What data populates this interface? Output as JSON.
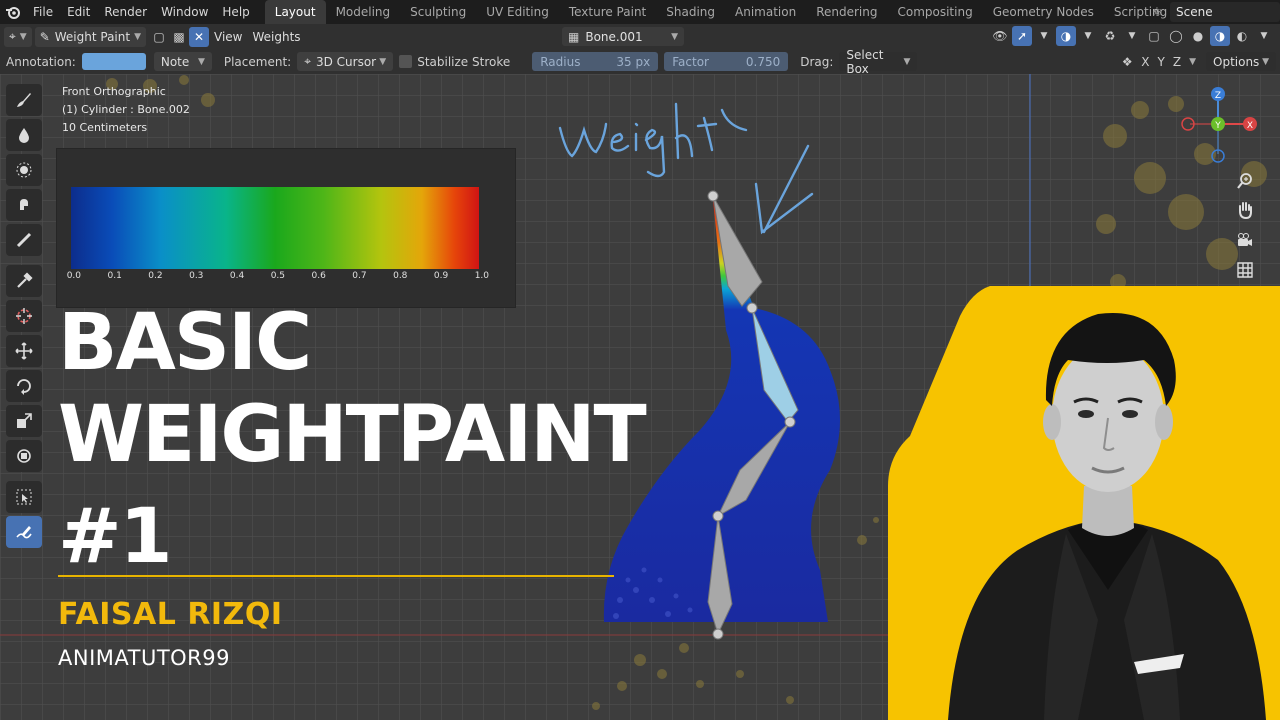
{
  "topbar": {
    "menus": [
      "File",
      "Edit",
      "Render",
      "Window",
      "Help"
    ],
    "workspaces": [
      "Layout",
      "Modeling",
      "Sculpting",
      "UV Editing",
      "Texture Paint",
      "Shading",
      "Animation",
      "Rendering",
      "Compositing",
      "Geometry Nodes",
      "Scripting"
    ],
    "active_workspace": "Layout",
    "add_label": "+",
    "scene": "Scene"
  },
  "header": {
    "mode": "Weight Paint",
    "view": "View",
    "weights": "Weights",
    "bone": "Bone.001"
  },
  "toolsettings": {
    "annotation_label": "Annotation:",
    "annotation_color": "#6aa4dc",
    "note": "Note",
    "placement_label": "Placement:",
    "placement": "3D Cursor",
    "stabilize": "Stabilize Stroke",
    "radius_label": "Radius",
    "radius_value": "35 px",
    "factor_label": "Factor",
    "factor_value": "0.750",
    "drag_label": "Drag:",
    "drag_value": "Select Box",
    "axes": [
      "X",
      "Y",
      "Z"
    ],
    "options": "Options"
  },
  "viewport": {
    "info": [
      "Front Orthographic",
      "(1) Cylinder : Bone.002",
      "10 Centimeters"
    ],
    "scale_ticks": [
      "0.0",
      "0.1",
      "0.2",
      "0.3",
      "0.4",
      "0.5",
      "0.6",
      "0.7",
      "0.8",
      "0.9",
      "1.0"
    ],
    "annotation_text": "Weight",
    "gizmo": {
      "z": "Z",
      "y": "Y",
      "x": "X"
    }
  },
  "thumbnail": {
    "title_line1": "BASIC",
    "title_line2": "WEIGHTPAINT",
    "title_line3": "#1",
    "author": "FAISAL RIZQI",
    "channel": "ANIMATUTOR99"
  },
  "colors": {
    "accent_yellow": "#f2b90c",
    "selected_blue": "#4772b3",
    "annotation_blue": "#6aa4dc"
  }
}
